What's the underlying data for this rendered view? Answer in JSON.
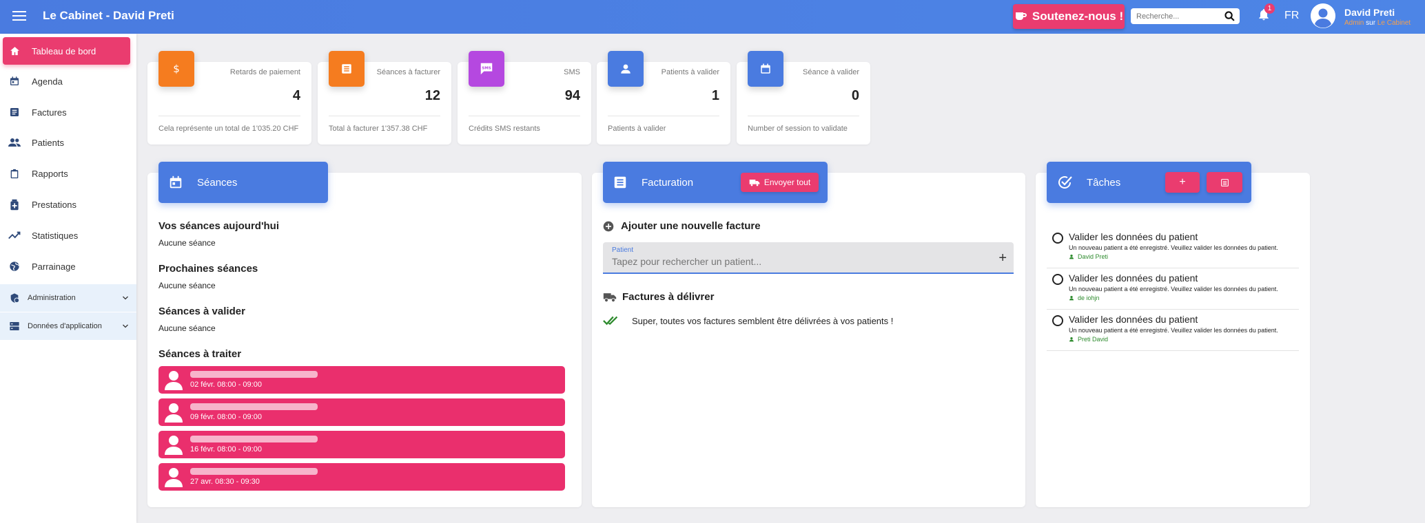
{
  "header": {
    "app_title": "Le Cabinet - David Preti",
    "support_label": "Soutenez-nous !",
    "search_placeholder": "Recherche...",
    "notification_count": "1",
    "language": "FR",
    "user_name": "David Preti",
    "user_role": "Admin",
    "user_role_sep": "sur",
    "user_org": "Le Cabinet"
  },
  "sidebar": {
    "items": [
      {
        "label": "Tableau de bord",
        "icon": "home-icon"
      },
      {
        "label": "Agenda",
        "icon": "calendar-icon"
      },
      {
        "label": "Factures",
        "icon": "invoice-icon"
      },
      {
        "label": "Patients",
        "icon": "people-icon"
      },
      {
        "label": "Rapports",
        "icon": "clipboard-icon"
      },
      {
        "label": "Prestations",
        "icon": "medical-box-icon"
      },
      {
        "label": "Statistiques",
        "icon": "trend-icon"
      },
      {
        "label": "Parrainage",
        "icon": "globe-icon"
      }
    ],
    "groups": [
      {
        "label": "Administration",
        "icon": "admin-icon"
      },
      {
        "label": "Données d'application",
        "icon": "storage-icon"
      }
    ]
  },
  "stats": [
    {
      "label": "Retards de paiement",
      "value": "4",
      "footer": "Cela représente un total de 1'035.20 CHF",
      "color": "#f57c1f",
      "icon": "dollar-icon"
    },
    {
      "label": "Séances à facturer",
      "value": "12",
      "footer": "Total à facturer 1'357.38 CHF",
      "color": "#f57c1f",
      "icon": "receipt-icon"
    },
    {
      "label": "SMS",
      "value": "94",
      "footer": "Crédits SMS restants",
      "color": "#b548e0",
      "icon": "sms-icon"
    },
    {
      "label": "Patients à valider",
      "value": "1",
      "footer": "Patients à valider",
      "color": "#4a7be0",
      "icon": "person-icon"
    },
    {
      "label": "Séance à valider",
      "value": "0",
      "footer": "Number of session to validate",
      "color": "#4a7be0",
      "icon": "calendar-icon"
    }
  ],
  "seances": {
    "title": "Séances",
    "today_title": "Vos séances aujourd'hui",
    "today_text": "Aucune séance",
    "next_title": "Prochaines séances",
    "next_text": "Aucune séance",
    "validate_title": "Séances à valider",
    "validate_text": "Aucune séance",
    "treat_title": "Séances à traiter",
    "rows": [
      {
        "time": "02 févr. 08:00 - 09:00"
      },
      {
        "time": "09 févr. 08:00 - 09:00"
      },
      {
        "time": "16 févr. 08:00 - 09:00"
      },
      {
        "time": "27 avr. 08:30 - 09:30"
      }
    ]
  },
  "facturation": {
    "title": "Facturation",
    "send_all": "Envoyer tout",
    "add_label": "Ajouter une nouvelle facture",
    "patient_label": "Patient",
    "patient_placeholder": "Tapez pour rechercher un patient...",
    "deliver_title": "Factures à délivrer",
    "deliver_text": "Super, toutes vos factures semblent être délivrées à vos patients !"
  },
  "taches": {
    "title": "Tâches",
    "add_label": "+",
    "items": [
      {
        "title": "Valider les données du patient",
        "desc": "Un nouveau patient a été enregistré. Veuillez valider les données du patient.",
        "user": "David Preti"
      },
      {
        "title": "Valider les données du patient",
        "desc": "Un nouveau patient a été enregistré. Veuillez valider les données du patient.",
        "user": "de iohjn"
      },
      {
        "title": "Valider les données du patient",
        "desc": "Un nouveau patient a été enregistré. Veuillez valider les données du patient.",
        "user": "Preti David"
      }
    ]
  },
  "colors": {
    "primary": "#4a7be0",
    "accent": "#ea3c6f",
    "orange": "#f57c1f",
    "purple": "#b548e0",
    "success": "#2e8b2e"
  }
}
